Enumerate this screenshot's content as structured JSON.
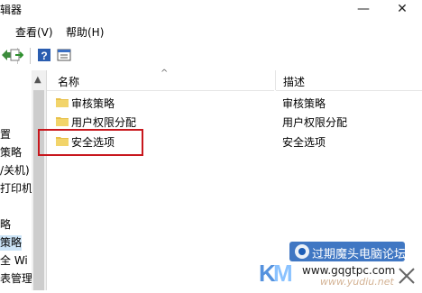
{
  "window": {
    "title": "辑器"
  },
  "menu": [
    {
      "label": "查看(V)"
    },
    {
      "label": "帮助(H)"
    }
  ],
  "toolbar": [
    "back-icon",
    "forward-icon",
    "export-list-icon",
    "help-icon",
    "properties-icon"
  ],
  "sidebar": {
    "items": [
      "置",
      "策略",
      "/关机)",
      "打印机",
      "略",
      "策略",
      "全 Wi",
      "表管理"
    ]
  },
  "list": {
    "columns": {
      "name": "名称",
      "description": "描述"
    },
    "rows": [
      {
        "name": "审核策略",
        "description": "审核策略"
      },
      {
        "name": "用户权限分配",
        "description": "用户权限分配"
      },
      {
        "name": "安全选项",
        "description": "安全选项",
        "highlighted": true
      }
    ]
  },
  "watermark": {
    "line1": "过期魔头电脑论坛",
    "line2": "www.gqgtpc.com",
    "line3": "www.yudiu.net"
  },
  "colors": {
    "highlight": "#c8171d",
    "folder": "#e8c04a"
  }
}
